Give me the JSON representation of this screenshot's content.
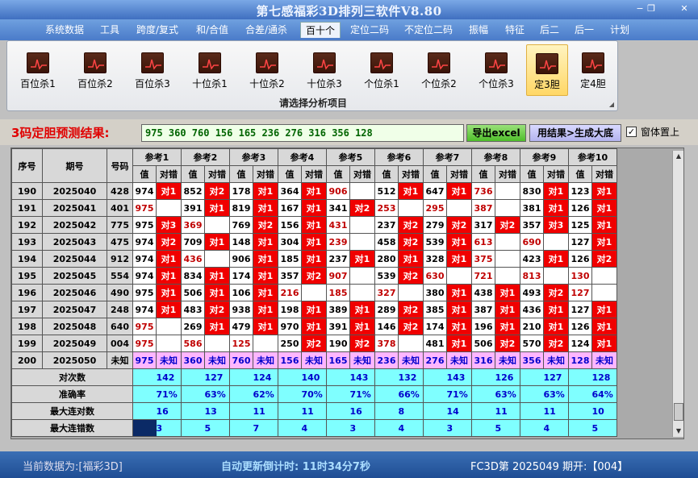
{
  "window": {
    "title": "第七感福彩3D排列三软件V8.80",
    "minimize": "−",
    "maximize": "❐",
    "close": "✕"
  },
  "menu": [
    "系统数据",
    "工具",
    "跨度/复式",
    "和/合值",
    "合差/通杀",
    "百十个",
    "定位二码",
    "不定位二码",
    "振幅",
    "特征",
    "后二",
    "后一",
    "计划"
  ],
  "ribbon": {
    "buttons": [
      "百位杀1",
      "百位杀2",
      "百位杀3",
      "十位杀1",
      "十位杀2",
      "十位杀3",
      "个位杀1",
      "个位杀2",
      "个位杀3",
      "定3胆",
      "定4胆"
    ],
    "caption": "请选择分析项目"
  },
  "result": {
    "label": "3码定胆预测结果:",
    "value": "975 360 760 156 165 236 276 316 356 128",
    "export_label": "导出excel",
    "gen_label": "用结果>生成大底",
    "topmost_label": "窗体置上",
    "topmost_checked": "✓"
  },
  "grid": {
    "headers": {
      "seq": "序号",
      "issue": "期号",
      "code": "号码"
    },
    "ref_labels": [
      "参考1",
      "参考2",
      "参考3",
      "参考4",
      "参考5",
      "参考6",
      "参考7",
      "参考8",
      "参考9",
      "参考10"
    ],
    "sub_val": "值",
    "sub_mark": "对错",
    "rows": [
      {
        "seq": "190",
        "issue": "2025040",
        "code": "428",
        "cells": [
          [
            "974",
            "对1",
            1,
            0
          ],
          [
            "852",
            "对2",
            1,
            0
          ],
          [
            "178",
            "对1",
            1,
            0
          ],
          [
            "364",
            "对1",
            1,
            0
          ],
          [
            "906",
            "",
            0,
            1
          ],
          [
            "512",
            "对1",
            1,
            0
          ],
          [
            "647",
            "对1",
            1,
            0
          ],
          [
            "736",
            "",
            0,
            1
          ],
          [
            "830",
            "对1",
            1,
            0
          ],
          [
            "123",
            "对1",
            1,
            0
          ]
        ]
      },
      {
        "seq": "191",
        "issue": "2025041",
        "code": "401",
        "cells": [
          [
            "975",
            "",
            0,
            1
          ],
          [
            "391",
            "对1",
            1,
            0
          ],
          [
            "819",
            "对1",
            1,
            0
          ],
          [
            "167",
            "对1",
            1,
            0
          ],
          [
            "341",
            "对2",
            1,
            0
          ],
          [
            "253",
            "",
            0,
            1
          ],
          [
            "295",
            "",
            0,
            1
          ],
          [
            "387",
            "",
            0,
            1
          ],
          [
            "381",
            "对1",
            1,
            0
          ],
          [
            "126",
            "对1",
            1,
            0
          ]
        ]
      },
      {
        "seq": "192",
        "issue": "2025042",
        "code": "775",
        "cells": [
          [
            "975",
            "对3",
            1,
            0
          ],
          [
            "369",
            "",
            0,
            1
          ],
          [
            "769",
            "对2",
            1,
            0
          ],
          [
            "156",
            "对1",
            1,
            0
          ],
          [
            "431",
            "",
            0,
            1
          ],
          [
            "237",
            "对2",
            1,
            0
          ],
          [
            "279",
            "对2",
            1,
            0
          ],
          [
            "317",
            "对2",
            1,
            0
          ],
          [
            "357",
            "对3",
            1,
            0
          ],
          [
            "125",
            "对1",
            1,
            0
          ]
        ]
      },
      {
        "seq": "193",
        "issue": "2025043",
        "code": "475",
        "cells": [
          [
            "974",
            "对2",
            1,
            0
          ],
          [
            "709",
            "对1",
            1,
            0
          ],
          [
            "148",
            "对1",
            1,
            0
          ],
          [
            "304",
            "对1",
            1,
            0
          ],
          [
            "239",
            "",
            0,
            1
          ],
          [
            "458",
            "对2",
            1,
            0
          ],
          [
            "539",
            "对1",
            1,
            0
          ],
          [
            "613",
            "",
            0,
            1
          ],
          [
            "690",
            "",
            0,
            1
          ],
          [
            "127",
            "对1",
            1,
            0
          ]
        ]
      },
      {
        "seq": "194",
        "issue": "2025044",
        "code": "912",
        "cells": [
          [
            "974",
            "对1",
            1,
            0
          ],
          [
            "436",
            "",
            0,
            1
          ],
          [
            "906",
            "对1",
            1,
            0
          ],
          [
            "185",
            "对1",
            1,
            0
          ],
          [
            "237",
            "对1",
            1,
            0
          ],
          [
            "280",
            "对1",
            1,
            0
          ],
          [
            "328",
            "对1",
            1,
            0
          ],
          [
            "375",
            "",
            0,
            1
          ],
          [
            "423",
            "对1",
            1,
            0
          ],
          [
            "126",
            "对2",
            1,
            0
          ]
        ]
      },
      {
        "seq": "195",
        "issue": "2025045",
        "code": "554",
        "cells": [
          [
            "974",
            "对1",
            1,
            0
          ],
          [
            "834",
            "对1",
            1,
            0
          ],
          [
            "174",
            "对1",
            1,
            0
          ],
          [
            "357",
            "对2",
            1,
            0
          ],
          [
            "907",
            "",
            0,
            1
          ],
          [
            "539",
            "对2",
            1,
            0
          ],
          [
            "630",
            "",
            0,
            1
          ],
          [
            "721",
            "",
            0,
            1
          ],
          [
            "813",
            "",
            0,
            1
          ],
          [
            "130",
            "",
            0,
            1
          ]
        ]
      },
      {
        "seq": "196",
        "issue": "2025046",
        "code": "490",
        "cells": [
          [
            "975",
            "对1",
            1,
            0
          ],
          [
            "506",
            "对1",
            1,
            0
          ],
          [
            "106",
            "对1",
            1,
            0
          ],
          [
            "216",
            "",
            0,
            1
          ],
          [
            "185",
            "",
            0,
            1
          ],
          [
            "327",
            "",
            0,
            1
          ],
          [
            "380",
            "对1",
            1,
            0
          ],
          [
            "438",
            "对1",
            1,
            0
          ],
          [
            "493",
            "对2",
            1,
            0
          ],
          [
            "127",
            "",
            0,
            1
          ]
        ]
      },
      {
        "seq": "197",
        "issue": "2025047",
        "code": "248",
        "cells": [
          [
            "974",
            "对1",
            1,
            0
          ],
          [
            "483",
            "对2",
            1,
            0
          ],
          [
            "938",
            "对1",
            1,
            0
          ],
          [
            "198",
            "对1",
            1,
            0
          ],
          [
            "389",
            "对1",
            1,
            0
          ],
          [
            "289",
            "对2",
            1,
            0
          ],
          [
            "385",
            "对1",
            1,
            0
          ],
          [
            "387",
            "对1",
            1,
            0
          ],
          [
            "436",
            "对1",
            1,
            0
          ],
          [
            "127",
            "对1",
            1,
            0
          ]
        ]
      },
      {
        "seq": "198",
        "issue": "2025048",
        "code": "640",
        "cells": [
          [
            "975",
            "",
            0,
            1
          ],
          [
            "269",
            "对1",
            1,
            0
          ],
          [
            "479",
            "对1",
            1,
            0
          ],
          [
            "970",
            "对1",
            1,
            0
          ],
          [
            "391",
            "对1",
            1,
            0
          ],
          [
            "146",
            "对2",
            1,
            0
          ],
          [
            "174",
            "对1",
            1,
            0
          ],
          [
            "196",
            "对1",
            1,
            0
          ],
          [
            "210",
            "对1",
            1,
            0
          ],
          [
            "126",
            "对1",
            1,
            0
          ]
        ]
      },
      {
        "seq": "199",
        "issue": "2025049",
        "code": "004",
        "cells": [
          [
            "975",
            "",
            0,
            1
          ],
          [
            "586",
            "",
            0,
            1
          ],
          [
            "125",
            "",
            0,
            1
          ],
          [
            "250",
            "对2",
            1,
            0
          ],
          [
            "190",
            "对2",
            1,
            0
          ],
          [
            "378",
            "",
            0,
            1
          ],
          [
            "481",
            "对1",
            1,
            0
          ],
          [
            "506",
            "对2",
            1,
            0
          ],
          [
            "570",
            "对2",
            1,
            0
          ],
          [
            "124",
            "对1",
            1,
            0
          ]
        ]
      }
    ],
    "pending": {
      "seq": "200",
      "issue": "2025050",
      "code": "未知",
      "vals": [
        "975",
        "360",
        "760",
        "156",
        "165",
        "236",
        "276",
        "316",
        "356",
        "128"
      ],
      "mark": "未知"
    },
    "stats": [
      {
        "label": "对次数",
        "values": [
          "142",
          "127",
          "124",
          "140",
          "143",
          "132",
          "143",
          "126",
          "127",
          "128"
        ]
      },
      {
        "label": "准确率",
        "values": [
          "71%",
          "63%",
          "62%",
          "70%",
          "71%",
          "66%",
          "71%",
          "63%",
          "63%",
          "64%"
        ]
      },
      {
        "label": "最大连对数",
        "values": [
          "16",
          "13",
          "11",
          "11",
          "16",
          "8",
          "14",
          "11",
          "11",
          "10"
        ]
      },
      {
        "label": "最大连错数",
        "values": [
          "3",
          "5",
          "7",
          "4",
          "3",
          "4",
          "3",
          "5",
          "4",
          "5"
        ]
      }
    ]
  },
  "status": {
    "left": "当前数据为:[福彩3D]",
    "middle": "自动更新倒计时:  11时34分7秒",
    "right": "FC3D第 2025049 期开:【004】"
  }
}
